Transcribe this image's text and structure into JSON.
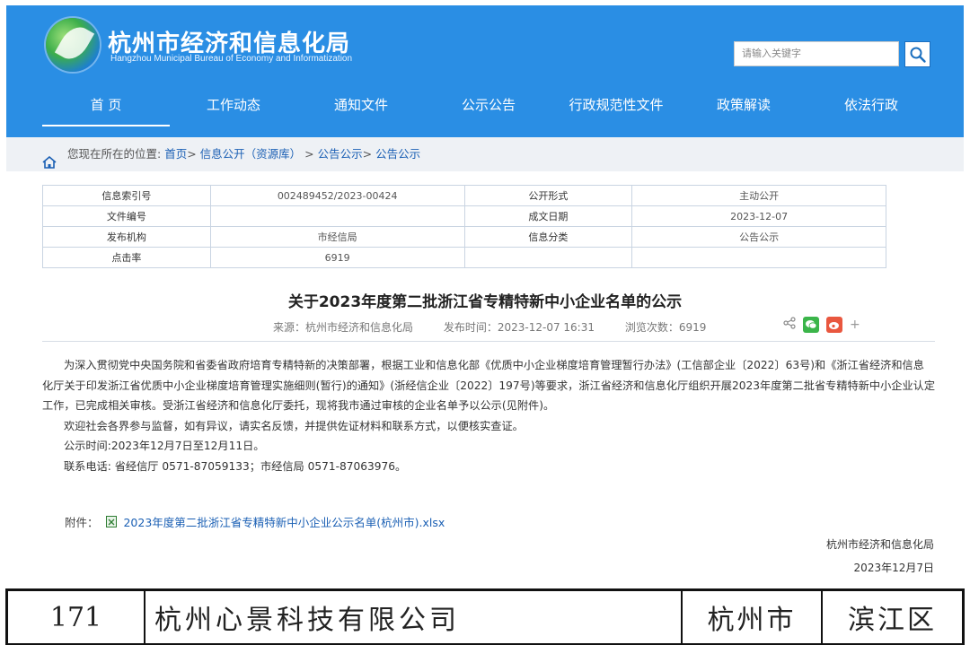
{
  "header": {
    "title": "杭州市经济和信息化局",
    "subtitle": "Hangzhou Municipal Bureau of Economy and Informatization",
    "search_placeholder": "请输入关键字"
  },
  "nav": [
    {
      "label": "首 页",
      "active": true
    },
    {
      "label": "工作动态"
    },
    {
      "label": "通知文件"
    },
    {
      "label": "公示公告"
    },
    {
      "label": "行政规范性文件"
    },
    {
      "label": "政策解读"
    },
    {
      "label": "依法行政"
    }
  ],
  "breadcrumb": {
    "prefix": "您现在所在的位置:",
    "items": [
      "首页",
      "信息公开（资源库）",
      "公告公示",
      "公告公示"
    ]
  },
  "meta": {
    "index_label": "信息索引号",
    "index_value": "002489452/2023-00424",
    "form_label": "公开形式",
    "form_value": "主动公开",
    "docno_label": "文件编号",
    "docno_value": "",
    "date_label": "成文日期",
    "date_value": "2023-12-07",
    "org_label": "发布机构",
    "org_value": "市经信局",
    "cat_label": "信息分类",
    "cat_value": "公告公示",
    "hits_label": "点击率",
    "hits_value": "6919"
  },
  "article": {
    "title": "关于2023年度第二批浙江省专精特新中小企业名单的公示",
    "source": "来源：杭州市经济和信息化局",
    "pubtime": "发布时间：2023-12-07 16:31",
    "views": "浏览次数：6919",
    "p1": "为深入贯彻党中央国务院和省委省政府培育专精特新的决策部署，根据工业和信息化部《优质中小企业梯度培育管理暂行办法》(工信部企业〔2022〕63号)和《浙江省经济和信息化厅关于印发浙江省优质中小企业梯度培育管理实施细则(暂行)的通知》(浙经信企业〔2022〕197号)等要求，浙江省经济和信息化厅组织开展2023年度第二批省专精特新中小企业认定工作，已完成相关审核。受浙江省经济和信息化厅委托，现将我市通过审核的企业名单予以公示(见附件)。",
    "p2": "欢迎社会各界参与监督，如有异议，请实名反馈，并提供佐证材料和联系方式，以便核实查证。",
    "p3": "公示时间:2023年12月7日至12月11日。",
    "p4": "联系电话: 省经信厅 0571-87059133；市经信局 0571-87063976。",
    "attach_label": "附件：",
    "attach_file": "2023年度第二批浙江省专精特新中小企业公示名单(杭州市).xlsx",
    "sign_org": "杭州市经济和信息化局",
    "sign_date": "2023年12月7日"
  },
  "bottom_row": {
    "num": "171",
    "company": "杭州心景科技有限公司",
    "city": "杭州市",
    "district": "滨江区"
  }
}
